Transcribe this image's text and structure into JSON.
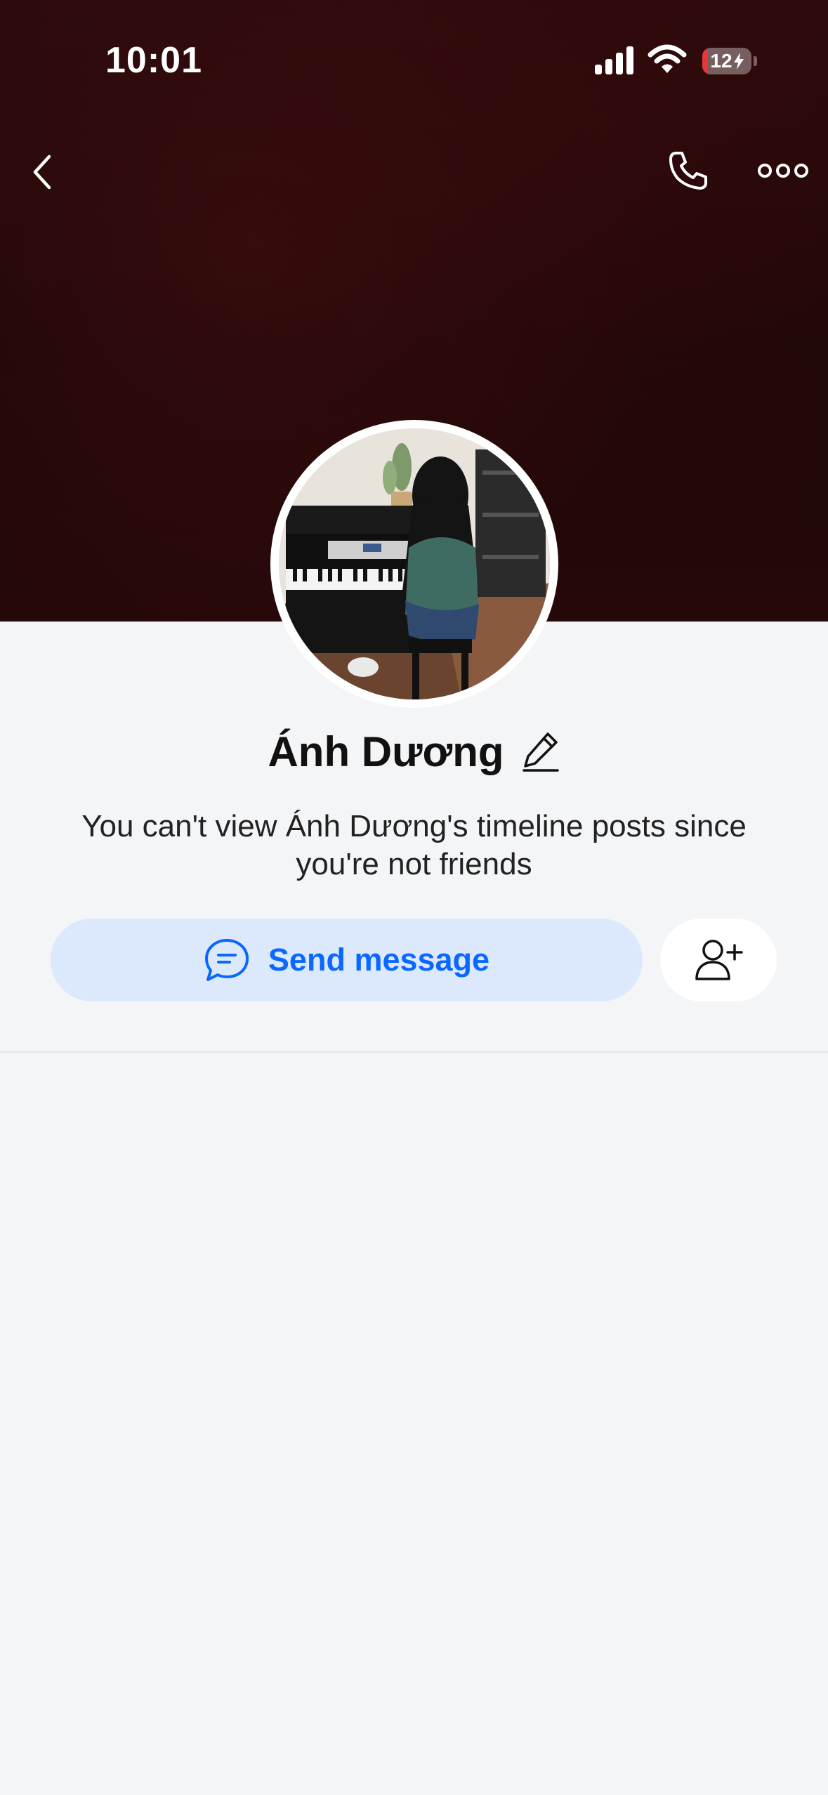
{
  "status_bar": {
    "time": "10:01",
    "battery_level": "12",
    "battery_percent": 12,
    "battery_color": "#e5383b",
    "icons": [
      "signal-icon",
      "wifi-icon",
      "battery-icon",
      "charging-bolt-icon"
    ]
  },
  "nav": {
    "icons": [
      "chevron-left-icon",
      "phone-icon",
      "more-dots-icon"
    ]
  },
  "profile": {
    "name": "Ánh Dương",
    "notice": "You can't view Ánh Dương's timeline posts since you're not friends",
    "avatar_description_icon": "avatar-photo"
  },
  "actions": {
    "send_message_label": "Send message",
    "icons": [
      "chat-bubble-icon",
      "add-friend-icon",
      "edit-pencil-icon"
    ]
  },
  "colors": {
    "accent": "#0a68ff",
    "accent_light": "#dce9fd",
    "background": "#f4f5f7",
    "cover": "#1e0707"
  }
}
